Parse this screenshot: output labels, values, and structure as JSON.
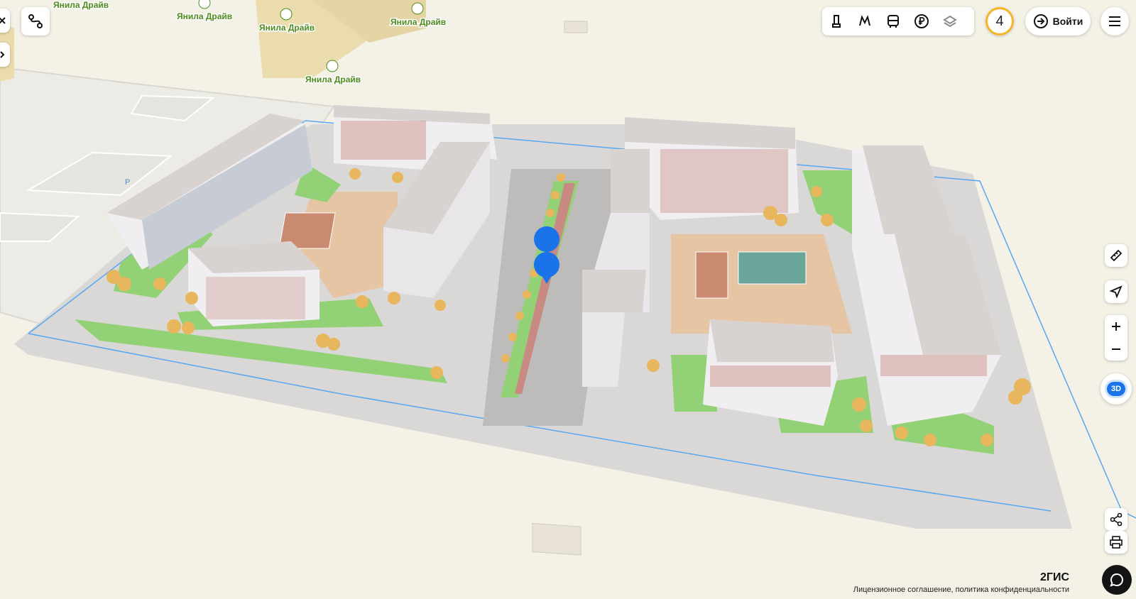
{
  "map": {
    "poi_labels": [
      "Янила Драйв",
      "Янила Драйв",
      "Янила Драйв",
      "Янила Драйв",
      "Янила Драйв"
    ],
    "parking_label": "P",
    "colors": {
      "background": "#f4f2e6",
      "block_ground": "#d9d8d6",
      "road": "#bdbcbb",
      "lawn": "#92d175",
      "courtyard": "#e6c5a5",
      "building_roof": "#d8d2d0",
      "building_wall": "#f0eef0",
      "brick_accent": "#c98a84",
      "tree": "#e8b65c",
      "boundary": "#56a7f0",
      "marker": "#1a73e8",
      "sports_field": "#6aa59a"
    }
  },
  "left_controls": {
    "route_icon": "route-icon",
    "collapse_icon": "close-icon",
    "expand_icon": "chevron-right-icon"
  },
  "toolbar": {
    "icons": [
      "traffic-icon",
      "metro-icon",
      "bus-icon",
      "ruble-icon",
      "layers-icon"
    ]
  },
  "weather_badge": {
    "value": "4",
    "color": "#f5b326"
  },
  "login": {
    "label": "Войти",
    "icon": "login-icon"
  },
  "menu": {
    "icon": "menu-icon"
  },
  "right_controls": {
    "ruler_icon": "ruler-icon",
    "locate_icon": "locate-icon",
    "zoom_in_icon": "plus-icon",
    "zoom_out_icon": "minus-icon",
    "mode_label": "3D",
    "share_icon": "share-icon",
    "print_icon": "print-icon"
  },
  "footer": {
    "brand": "2ГИС",
    "legal": "Лицензионное соглашение, политика конфиденциальности"
  },
  "chat": {
    "icon": "chat-icon"
  }
}
